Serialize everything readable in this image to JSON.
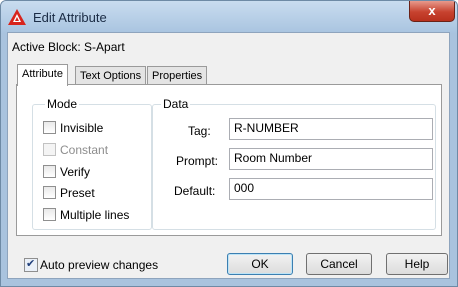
{
  "window": {
    "title": "Edit Attribute",
    "close_glyph": "x"
  },
  "active_block": "Active Block: S-Apart",
  "tabs": [
    {
      "label": "Attribute",
      "active": true
    },
    {
      "label": "Text Options",
      "active": false
    },
    {
      "label": "Properties",
      "active": false
    }
  ],
  "mode": {
    "title": "Mode",
    "options": [
      {
        "label": "Invisible",
        "checked": false,
        "enabled": true
      },
      {
        "label": "Constant",
        "checked": false,
        "enabled": false
      },
      {
        "label": "Verify",
        "checked": false,
        "enabled": true
      },
      {
        "label": "Preset",
        "checked": false,
        "enabled": true
      },
      {
        "label": "Multiple lines",
        "checked": false,
        "enabled": true
      }
    ]
  },
  "data_group": {
    "title": "Data",
    "tag_label": "Tag:",
    "tag_value": "R-NUMBER",
    "prompt_label": "Prompt:",
    "prompt_value": "Room Number",
    "default_label": "Default:",
    "default_value": "000"
  },
  "footer": {
    "auto_preview_label": "Auto preview changes",
    "auto_preview_checked": true,
    "ok_label": "OK",
    "cancel_label": "Cancel",
    "help_label": "Help"
  },
  "colors": {
    "title_bar": "#a9c4e0",
    "close_button": "#c7422f",
    "dialog_background": "#f0f0f0",
    "app_icon": "#d8241c"
  }
}
